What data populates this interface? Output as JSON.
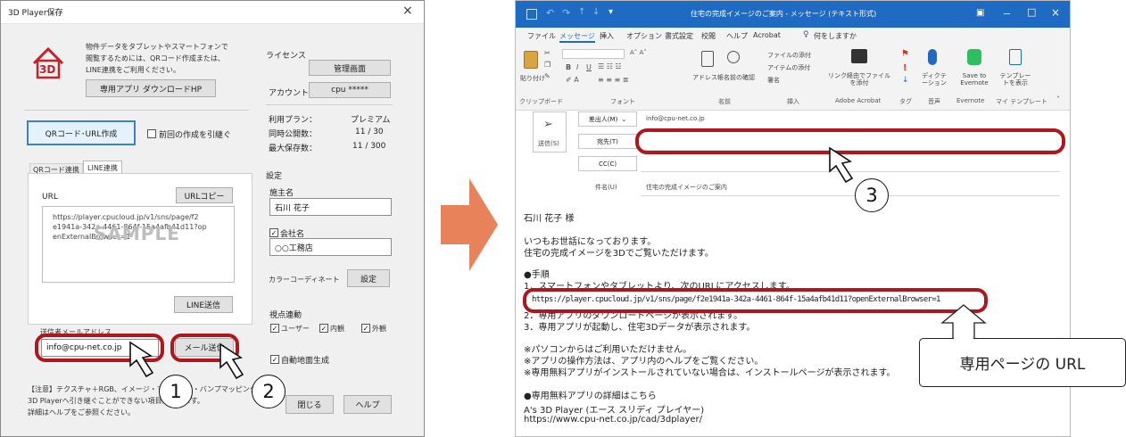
{
  "dialog": {
    "title": "3D Player保存",
    "close_glyph": "×",
    "logo_text": "3D",
    "info_lines": [
      "物件データをタブレットやスマートフォンで",
      "閲覧するためには、QRコード作成または、",
      "LINE連携をご利用ください。"
    ],
    "download_button": "専用アプリ ダウンロードHP",
    "license_label": "ライセンス",
    "admin_button": "管理画面",
    "account_label": "アカウント",
    "account_value": "cpu *****",
    "plan_label": "利用プラン：",
    "plan_value": "プレミアム",
    "concurrent_label": "同時公開数：",
    "concurrent_value": "11 / 30",
    "max_storage_label": "最大保存数：",
    "max_storage_value": "11 / 300",
    "qr_button": "QRコード･URL作成",
    "inherit_checkbox": "前回の作成を引継ぐ",
    "tabs": [
      "QRコード連携",
      "LINE連携"
    ],
    "url_label": "URL",
    "url_copy_button": "URLコピー",
    "url_text": [
      "https://player.cpucloud.jp/v1/sns/page/f2",
      "e1941a-342a-4461-864f-15a4afb41d11?op",
      "enExternalBrowser=1"
    ],
    "watermark": "SAMPLE",
    "line_send_button": "LINE送信",
    "sender_mail_label": "送信者メールアドレス",
    "sender_mail_value": "info@cpu-net.co.jp",
    "mail_send_button": "メール送信",
    "settings_label": "設定",
    "owner_label": "施主名",
    "owner_value": "石川 花子",
    "company_checkbox": "会社名",
    "company_value": "○○工務店",
    "color_label": "カラーコーディネート",
    "color_button": "設定",
    "viewpoint_label": "視点連動",
    "viewpoint_options": [
      "ユーザー",
      "内観",
      "外観"
    ],
    "auto_ground": "自動地面生成",
    "note_lines": [
      "【注意】テクスチャ＋RGB、イメージ・マッピング・バンプマッピング等、",
      "3D Playerへ引き継ぐことができない項目があります。",
      "詳細はヘルプをご参照ください。"
    ],
    "close_button": "閉じる",
    "help_button": "ヘルプ"
  },
  "callouts": {
    "one": "1",
    "two": "2",
    "three": "3"
  },
  "outlook": {
    "title": "住宅の完成イメージのご案内 - メッセージ (テキスト形式)",
    "title_controls": [
      "ー",
      "□",
      "×"
    ],
    "menu": [
      "ファイル",
      "メッセージ",
      "挿入",
      "オプション",
      "書式設定",
      "校閲",
      "ヘルプ",
      "Acrobat",
      "何をしますか"
    ],
    "ribbon_items": [
      "貼り付け",
      "アドレス帳",
      "名前の確認",
      "ファイルの添付",
      "アイテムの添付",
      "署名",
      "リンク経由でファイルを添付",
      "ディクテーション",
      "Save to Evernote",
      "テンプレートを表示"
    ],
    "ribbon_groups": [
      "クリップボード",
      "フォント",
      "名前",
      "挿入",
      "Adobe Acrobat",
      "タグ",
      "音声",
      "Evernote",
      "マイ テンプレート"
    ],
    "send_label": "送信(S)",
    "from_label": "差出人(M)",
    "from_value": "info@cpu-net.co.jp",
    "to_label": "宛先(T)",
    "cc_label": "CC(C)",
    "subject_label": "件名(U)",
    "subject_value": "住宅の完成イメージのご案内",
    "body": [
      "石川 花子 様",
      "いつもお世話になっております。",
      "住宅の完成イメージを3Dでご覧いただけます。",
      "●手順",
      "1．スマートフォンやタブレットより、次のURLにアクセスします。",
      "https://player.cpucloud.jp/v1/sns/page/f2e1941a-342a-4461-864f-15a4afb41d11?openExternalBrowser=1",
      "2．専用アプリのダウンロードページが表示されます。",
      "3．専用アプリが起動し、住宅3Dデータが表示されます。",
      "※パソコンからはご利用いただけません。",
      "※アプリの操作方法は、アプリ内のヘルプをご覧ください。",
      "※専用無料アプリがインストールされていない場合は、インストールページが表示されます。",
      "●専用無料アプリの詳細はこちら",
      "A's 3D Player (エース スリディ プレイヤー)",
      "https://www.cpu-net.co.jp/cad/3dplayer/"
    ],
    "url_callout": "専用ページの URL"
  },
  "colors": {
    "arrow": "#e8825a",
    "highlight_red": "#b0161d",
    "outlook_blue": "#1f6ac3"
  }
}
